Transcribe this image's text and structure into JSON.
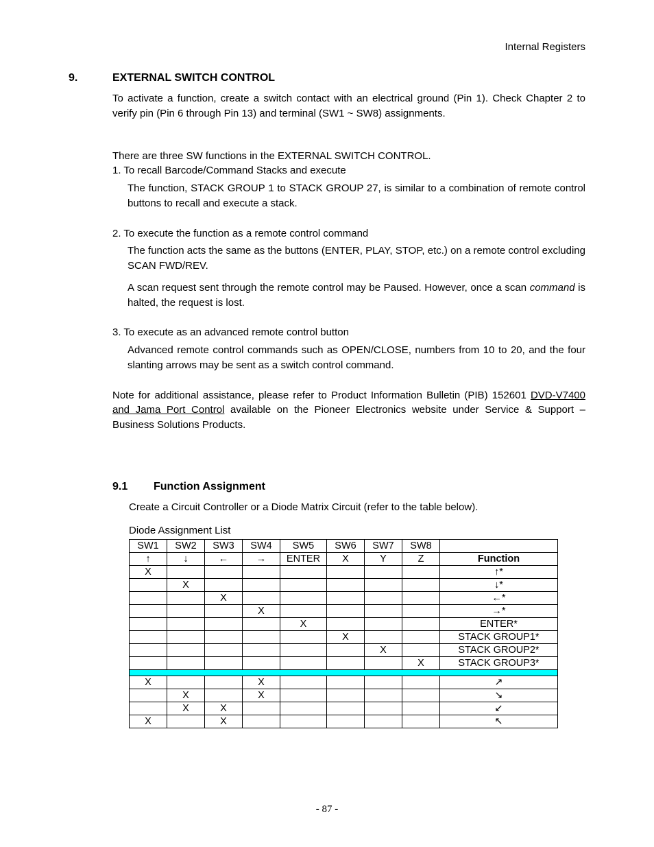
{
  "header": {
    "right": "Internal Registers"
  },
  "section": {
    "num": "9.",
    "title": "EXTERNAL SWITCH CONTROL",
    "p1": "To activate a function, create a switch contact with an electrical ground (Pin 1).  Check Chapter 2 to verify pin (Pin 6 through Pin 13) and terminal (SW1 ~ SW8) assignments.",
    "p2": "There are three SW functions in the EXTERNAL SWITCH CONTROL.",
    "item1_head": "1. To recall Barcode/Command Stacks and execute",
    "item1_body": "The function, STACK GROUP 1 to STACK GROUP 27, is similar to a combination of remote control buttons to recall and execute a stack.",
    "item2_head": "2. To execute the function as a remote control command",
    "item2_body1": "The function acts the same as the buttons (ENTER, PLAY, STOP, etc.) on a remote control excluding SCAN FWD/REV.",
    "item2_body2a": "A scan request sent through the remote control may be Paused.  However, once a scan ",
    "item2_body2_em": "command",
    "item2_body2b": " is halted, the request is lost.",
    "item3_head": "3. To execute as an advanced remote control button",
    "item3_body": "Advanced remote control commands such as OPEN/CLOSE, numbers from 10 to 20, and the four slanting arrows may be sent as a switch control command.",
    "note_a": "Note for additional assistance, please refer to Product Information Bulletin (PIB) 152601 ",
    "note_u": "DVD-V7400 and Jama Port Control",
    "note_b": " available on the Pioneer Electronics website under Service & Support – Business Solutions Products."
  },
  "subsection": {
    "num": "9.1",
    "title": "Function Assignment",
    "p1": "Create a Circuit Controller or a Diode Matrix Circuit (refer to the table below).",
    "caption": "Diode Assignment List"
  },
  "table": {
    "headers": [
      "SW1",
      "SW2",
      "SW3",
      "SW4",
      "SW5",
      "SW6",
      "SW7",
      "SW8",
      ""
    ],
    "row2": [
      "↑",
      "↓",
      "←",
      "→",
      "ENTER",
      "X",
      "Y",
      "Z",
      "Function"
    ],
    "rows": [
      [
        "X",
        "",
        "",
        "",
        "",
        "",
        "",
        "",
        "↑*"
      ],
      [
        "",
        "X",
        "",
        "",
        "",
        "",
        "",
        "",
        "↓*"
      ],
      [
        "",
        "",
        "X",
        "",
        "",
        "",
        "",
        "",
        "←*"
      ],
      [
        "",
        "",
        "",
        "X",
        "",
        "",
        "",
        "",
        "→*"
      ],
      [
        "",
        "",
        "",
        "",
        "X",
        "",
        "",
        "",
        "ENTER*"
      ],
      [
        "",
        "",
        "",
        "",
        "",
        "X",
        "",
        "",
        "STACK GROUP1*"
      ],
      [
        "",
        "",
        "",
        "",
        "",
        "",
        "X",
        "",
        "STACK GROUP2*"
      ],
      [
        "",
        "",
        "",
        "",
        "",
        "",
        "",
        "X",
        "STACK GROUP3*"
      ]
    ],
    "rows2": [
      [
        "X",
        "",
        "",
        "X",
        "",
        "",
        "",
        "",
        "↗"
      ],
      [
        "",
        "X",
        "",
        "X",
        "",
        "",
        "",
        "",
        "↘"
      ],
      [
        "",
        "X",
        "X",
        "",
        "",
        "",
        "",
        "",
        "↙"
      ],
      [
        "X",
        "",
        "X",
        "",
        "",
        "",
        "",
        "",
        "↖"
      ]
    ]
  },
  "footer": {
    "page": "- 87 -"
  },
  "chart_data": {
    "type": "table",
    "title": "Diode Assignment List",
    "columns": [
      "SW1",
      "SW2",
      "SW3",
      "SW4",
      "SW5",
      "SW6",
      "SW7",
      "SW8",
      "Function"
    ],
    "header_symbols": [
      "↑",
      "↓",
      "←",
      "→",
      "ENTER",
      "X",
      "Y",
      "Z",
      "Function"
    ],
    "rows": [
      {
        "SW1": "X",
        "SW2": "",
        "SW3": "",
        "SW4": "",
        "SW5": "",
        "SW6": "",
        "SW7": "",
        "SW8": "",
        "Function": "↑*"
      },
      {
        "SW1": "",
        "SW2": "X",
        "SW3": "",
        "SW4": "",
        "SW5": "",
        "SW6": "",
        "SW7": "",
        "SW8": "",
        "Function": "↓*"
      },
      {
        "SW1": "",
        "SW2": "",
        "SW3": "X",
        "SW4": "",
        "SW5": "",
        "SW6": "",
        "SW7": "",
        "SW8": "",
        "Function": "←*"
      },
      {
        "SW1": "",
        "SW2": "",
        "SW3": "",
        "SW4": "X",
        "SW5": "",
        "SW6": "",
        "SW7": "",
        "SW8": "",
        "Function": "→*"
      },
      {
        "SW1": "",
        "SW2": "",
        "SW3": "",
        "SW4": "",
        "SW5": "X",
        "SW6": "",
        "SW7": "",
        "SW8": "",
        "Function": "ENTER*"
      },
      {
        "SW1": "",
        "SW2": "",
        "SW3": "",
        "SW4": "",
        "SW5": "",
        "SW6": "X",
        "SW7": "",
        "SW8": "",
        "Function": "STACK GROUP1*"
      },
      {
        "SW1": "",
        "SW2": "",
        "SW3": "",
        "SW4": "",
        "SW5": "",
        "SW6": "",
        "SW7": "X",
        "SW8": "",
        "Function": "STACK GROUP2*"
      },
      {
        "SW1": "",
        "SW2": "",
        "SW3": "",
        "SW4": "",
        "SW5": "",
        "SW6": "",
        "SW7": "",
        "SW8": "X",
        "Function": "STACK GROUP3*"
      },
      {
        "SW1": "X",
        "SW2": "",
        "SW3": "",
        "SW4": "X",
        "SW5": "",
        "SW6": "",
        "SW7": "",
        "SW8": "",
        "Function": "↗"
      },
      {
        "SW1": "",
        "SW2": "X",
        "SW3": "",
        "SW4": "X",
        "SW5": "",
        "SW6": "",
        "SW7": "",
        "SW8": "",
        "Function": "↘"
      },
      {
        "SW1": "",
        "SW2": "X",
        "SW3": "X",
        "SW4": "",
        "SW5": "",
        "SW6": "",
        "SW7": "",
        "SW8": "",
        "Function": "↙"
      },
      {
        "SW1": "X",
        "SW2": "",
        "SW3": "X",
        "SW4": "",
        "SW5": "",
        "SW6": "",
        "SW7": "",
        "SW8": "",
        "Function": "↖"
      }
    ]
  }
}
